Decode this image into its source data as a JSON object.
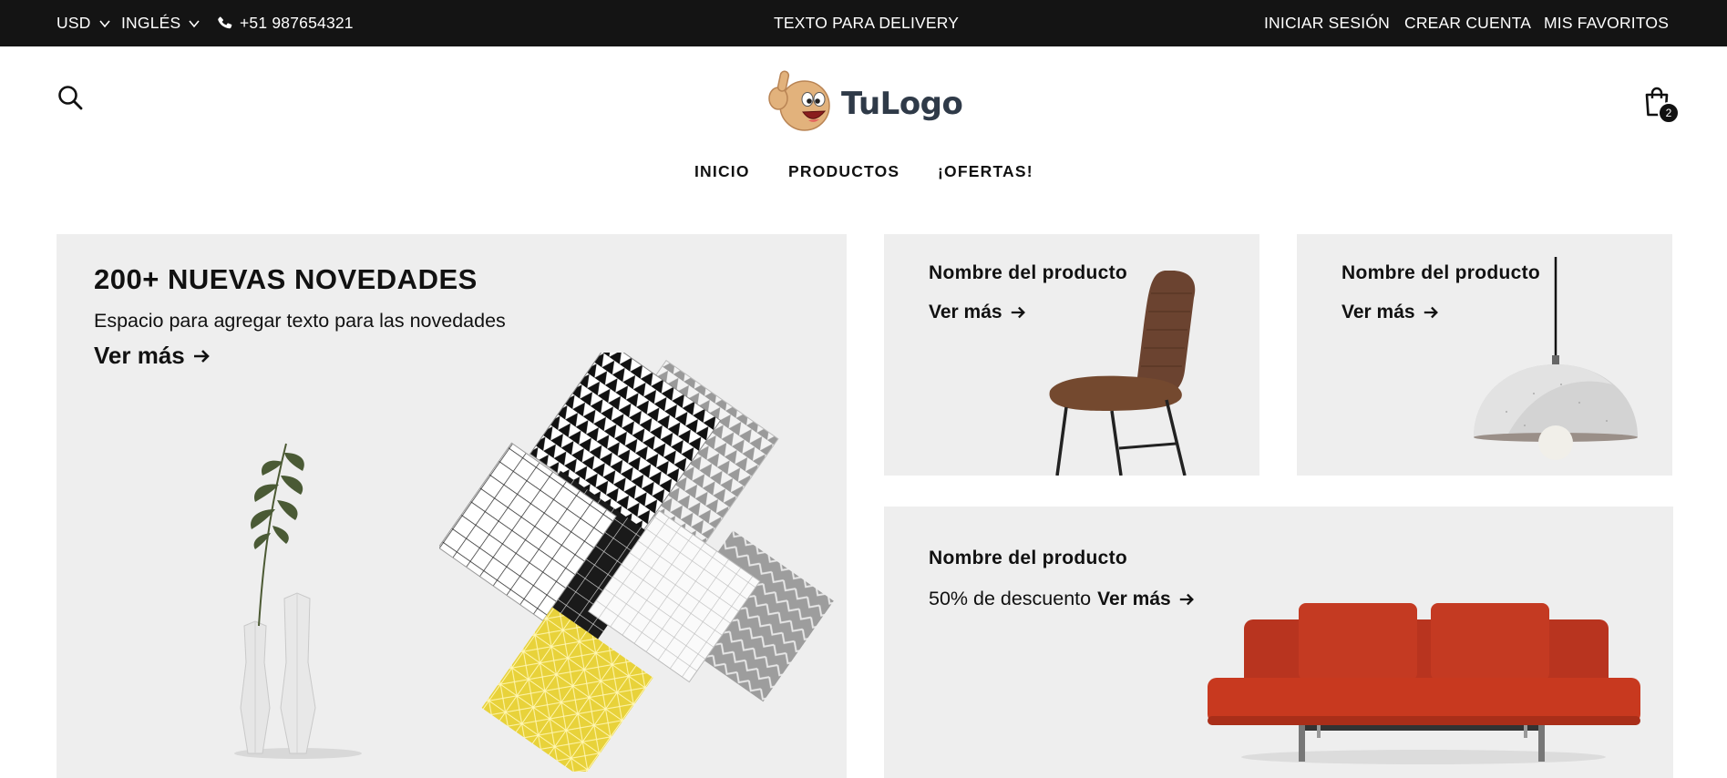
{
  "topbar": {
    "currency": "USD",
    "language": "INGLÉS",
    "phone": "+51 987654321",
    "delivery_text": "TEXTO PARA DELIVERY",
    "login": "INICIAR SESIÓN",
    "register": "CREAR CUENTA",
    "favorites": "MIS FAVORITOS"
  },
  "header": {
    "logo_text": "TuLogo",
    "cart_count": "2"
  },
  "nav": {
    "items": [
      "INICIO",
      "PRODUCTOS",
      "¡OFERTAS!"
    ]
  },
  "hero": {
    "title": "200+ NUEVAS NOVEDADES",
    "subtitle": "Espacio para agregar texto para las novedades",
    "link": "Ver más"
  },
  "cards": [
    {
      "title": "Nombre del producto",
      "link": "Ver más",
      "image": "brown-chair"
    },
    {
      "title": "Nombre del producto",
      "link": "Ver más",
      "image": "concrete-pendant-lamp"
    },
    {
      "title": "Nombre del producto",
      "discount": "50% de descuento",
      "link": "Ver más",
      "image": "red-sofa"
    }
  ],
  "colors": {
    "topbar_bg": "#141414",
    "panel_bg": "#eeeeee",
    "logo_text": "#2f3a48",
    "sofa": "#c43a22",
    "chair": "#6b4330",
    "fabric_yellow": "#e8d23a"
  }
}
